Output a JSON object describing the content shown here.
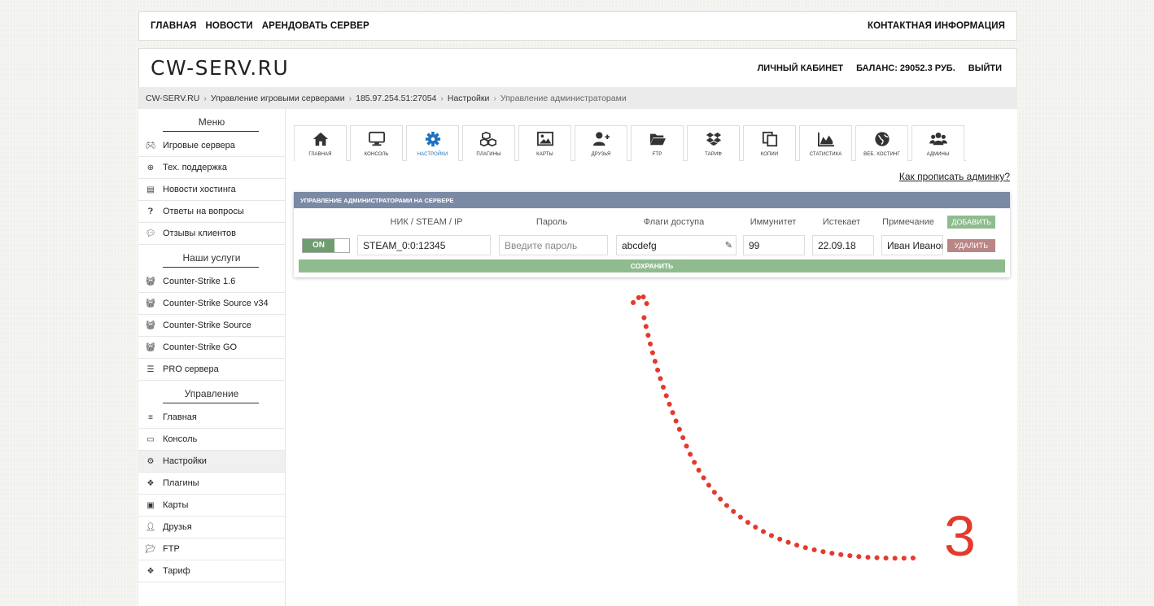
{
  "topnav": {
    "left": [
      "ГЛАВНАЯ",
      "НОВОСТИ",
      "АРЕНДОВАТЬ СЕРВЕР"
    ],
    "right": "КОНТАКТНАЯ ИНФОРМАЦИЯ"
  },
  "header": {
    "logo": "CW-SERV.RU",
    "cabinet": "ЛИЧНЫЙ КАБИНЕТ",
    "balance": "БАЛАНС: 29052.3 РУБ.",
    "logout": "ВЫЙТИ"
  },
  "breadcrumb": [
    "CW-SERV.RU",
    "Управление игровыми серверами",
    "185.97.254.51:27054",
    "Настройки",
    "Управление администраторами"
  ],
  "sidebar": {
    "menu_title": "Меню",
    "menu": [
      {
        "icon": "gamepad-icon",
        "label": "Игровые сервера"
      },
      {
        "icon": "lifebuoy-icon",
        "label": "Тех. поддержка"
      },
      {
        "icon": "newspaper-icon",
        "label": "Новости хостинга"
      },
      {
        "icon": "question-icon",
        "label": "Ответы на вопросы"
      },
      {
        "icon": "comments-icon",
        "label": "Отзывы клиентов"
      }
    ],
    "services_title": "Наши услуги",
    "services": [
      {
        "icon": "basket-icon",
        "label": "Counter-Strike 1.6"
      },
      {
        "icon": "basket-icon",
        "label": "Counter-Strike Source v34"
      },
      {
        "icon": "basket-icon",
        "label": "Counter-Strike Source"
      },
      {
        "icon": "basket-icon",
        "label": "Counter-Strike GO"
      },
      {
        "icon": "server-icon",
        "label": "PRO сервера"
      }
    ],
    "manage_title": "Управление",
    "manage": [
      {
        "icon": "bars-icon",
        "label": "Главная"
      },
      {
        "icon": "monitor-icon",
        "label": "Консоль"
      },
      {
        "icon": "gear-icon",
        "label": "Настройки"
      },
      {
        "icon": "cubes-icon",
        "label": "Плагины"
      },
      {
        "icon": "image-icon",
        "label": "Карты"
      },
      {
        "icon": "user-plus-icon",
        "label": "Друзья"
      },
      {
        "icon": "folder-icon",
        "label": "FTP"
      },
      {
        "icon": "dropbox-icon",
        "label": "Тариф"
      }
    ]
  },
  "tabs": [
    {
      "icon": "home-icon",
      "label": "ГЛАВНАЯ"
    },
    {
      "icon": "monitor-icon",
      "label": "КОНСОЛЬ"
    },
    {
      "icon": "gear-icon",
      "label": "НАСТРОЙКИ"
    },
    {
      "icon": "cubes-icon",
      "label": "ПЛАГИНЫ"
    },
    {
      "icon": "image-icon",
      "label": "КАРТЫ"
    },
    {
      "icon": "user-plus-icon",
      "label": "ДРУЗЬЯ"
    },
    {
      "icon": "folder-icon",
      "label": "FTP"
    },
    {
      "icon": "dropbox-icon",
      "label": "ТАРИФ"
    },
    {
      "icon": "copy-icon",
      "label": "КОПИИ"
    },
    {
      "icon": "area-chart-icon",
      "label": "СТАТИСТИКА"
    },
    {
      "icon": "globe-icon",
      "label": "ВЕБ. ХОСТИНГ"
    },
    {
      "icon": "users-icon",
      "label": "АДМИНЫ"
    }
  ],
  "help_link": "Как прописать админку?",
  "panel": {
    "title": "УПРАВЛЕНИЕ АДМИНИСТРАТОРАМИ НА СЕРВЕРЕ",
    "columns": {
      "nick": "НИК / STEAM / IP",
      "password": "Пароль",
      "flags": "Флаги доступа",
      "immunity": "Иммунитет",
      "expires": "Истекает",
      "note": "Примечание"
    },
    "add_button": "ДОБАВИТЬ",
    "row": {
      "toggle": "ON",
      "nick": "STEAM_0:0:12345",
      "password_placeholder": "Введите пароль",
      "flags": "abcdefg",
      "immunity": "99",
      "expires": "22.09.18",
      "note": "Иван Иванов"
    },
    "delete_button": "УДАЛИТЬ",
    "save_button": "СОХРАНИТЬ"
  },
  "annotation": {
    "number": "3",
    "color": "#e43a2e"
  },
  "colors": {
    "panel_header": "#7a8aa5",
    "green_button": "#8fbc8f",
    "red_button": "#b98585",
    "active_tab": "#1e73be"
  }
}
